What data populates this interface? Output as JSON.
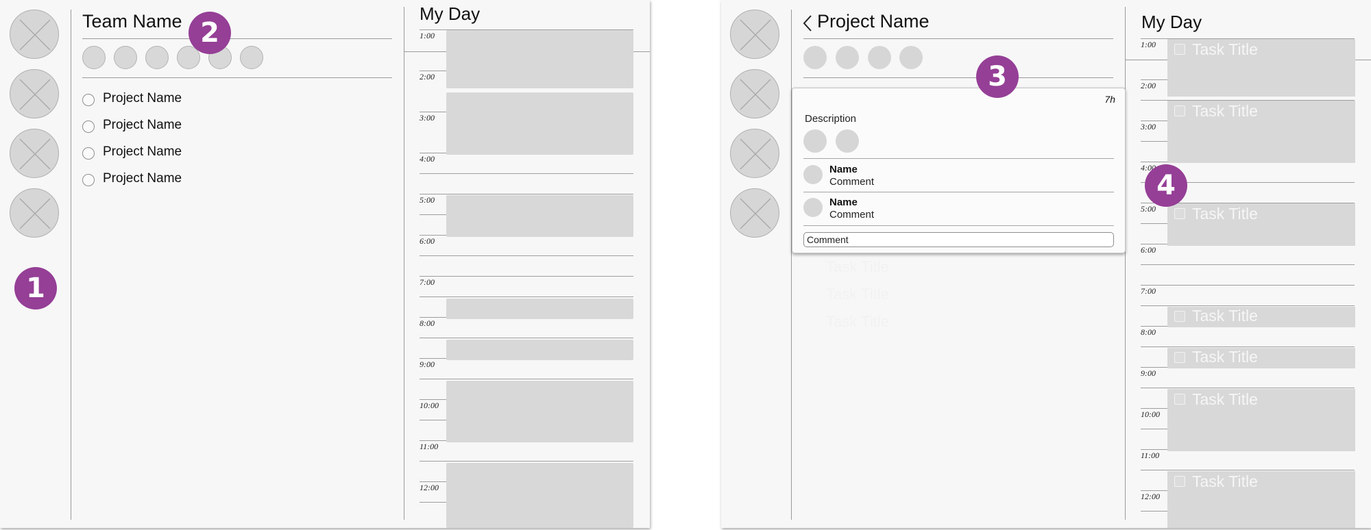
{
  "left_screen": {
    "team_title": "Team Name",
    "projects": [
      "Project Name",
      "Project Name",
      "Project Name",
      "Project Name"
    ],
    "my_day_title": "My Day",
    "times": [
      "1:00",
      "2:00",
      "3:00",
      "4:00",
      "5:00",
      "6:00",
      "7:00",
      "8:00",
      "9:00",
      "10:00",
      "11:00",
      "12:00"
    ]
  },
  "right_screen": {
    "project_title": "Project Name",
    "my_day_title": "My Day",
    "times": [
      "1:00",
      "2:00",
      "3:00",
      "4:00",
      "5:00",
      "6:00",
      "7:00",
      "8:00",
      "9:00",
      "10:00",
      "11:00",
      "12:00"
    ],
    "tasks": [
      "Task Title",
      "Task Title",
      "Task Title",
      "Task Title",
      "Task Title",
      "Task Title",
      "Task Title"
    ],
    "faint_items": [
      "Task Title",
      "Task Title",
      "Task Title"
    ],
    "task_card": {
      "estimate": "7h",
      "description_label": "Description",
      "comments": [
        {
          "name": "Name",
          "text": "Comment"
        },
        {
          "name": "Name",
          "text": "Comment"
        }
      ],
      "comment_input_placeholder": "Comment"
    }
  },
  "callouts": [
    "1",
    "2",
    "3",
    "4"
  ],
  "colors": {
    "callout": "#953f96",
    "placeholder_fill": "#d8d8d8",
    "frame_bg": "#f7f7f7",
    "divider": "#9a9a9a"
  },
  "icons": {
    "rail": "image-placeholder-icon",
    "back": "chevron-left-icon",
    "project_status": "radio-circle-icon",
    "task_status": "checkbox-icon"
  }
}
